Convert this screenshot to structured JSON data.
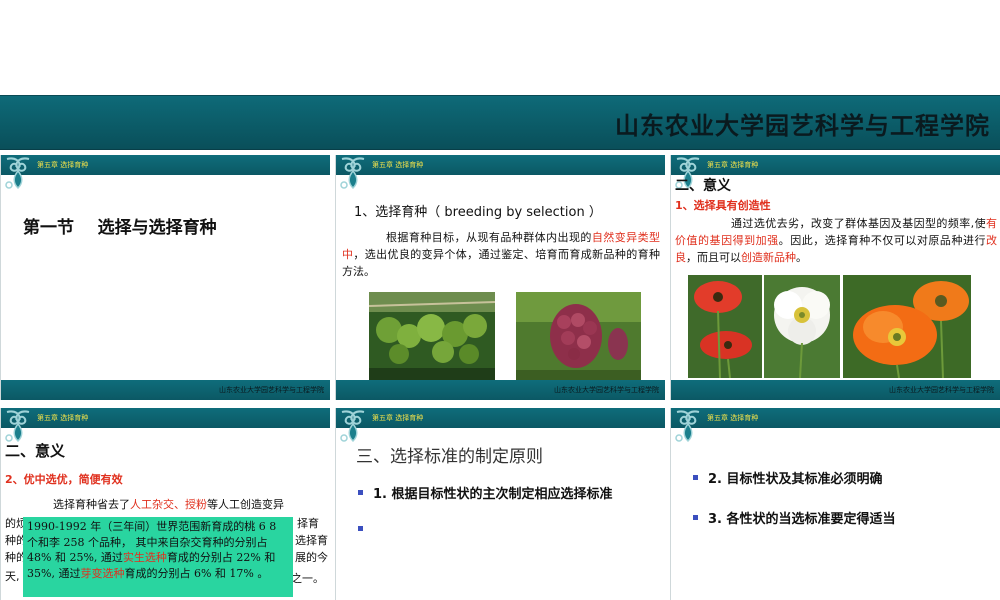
{
  "banner": {
    "title": "山东农业大学园艺科学与工程学院"
  },
  "common": {
    "chapter": "第五章  选择育种",
    "footer": "山东农业大学园艺科学与工程学院"
  },
  "slide1": {
    "title": "第一节    选择与选择育种"
  },
  "slide2": {
    "heading": "1、选择育种（ breeding by selection ）",
    "para_a": "根据育种目标，从现有品种群体内出现的",
    "para_red": "自然变异类型中",
    "para_b": "，选出优良的变异个体，通过鉴定、培育而育成新品种的育种方法。"
  },
  "slide3": {
    "heading": "二、意义",
    "sub": "1、选择具有创造性",
    "para_a": "通过选优去劣，改变了群体基因及基因型的频率,使",
    "para_red1": "有价值的基因得到加强",
    "para_b": "。因此，选择育种不仅可以对原品种进行",
    "para_red2": "改良",
    "para_c": "，而且可以",
    "para_red3": "创造新品种",
    "para_d": "。"
  },
  "slide4": {
    "heading": "二、意义",
    "sub": "2、优中选优，简便有效",
    "para_a": "选择育种省去了",
    "para_red1": "人工杂交、授粉",
    "para_b": "等人工创造变异",
    "line2_left": "的烦",
    "line2_right": "择育",
    "line3_left": "种的",
    "line3_right": "选择育",
    "line4_left": "种的",
    "line4_right": "展的今",
    "line5_left": "天,",
    "line5_right": "之一。",
    "popup_a": "1990-1992 年（三年间）世界范围新育成的桃 6 8 个和李 258 个品种， 其中来自杂交育种的分别占 48%  和 25%,  通过",
    "popup_red1": "实生选种",
    "popup_b": "育成的分别占 22%  和 35%,  通过",
    "popup_red2": "芽变选种",
    "popup_c": "育成的分别占 6%  和 17%  。"
  },
  "slide5": {
    "heading": "三、选择标准的制定原则",
    "bullet1": "1.  根据目标性状的主次制定相应选择标准",
    "bullet2": ""
  },
  "slide6": {
    "bullet1": "2.  目标性状及其标准必须明确",
    "bullet2": "3.  各性状的当选标准要定得适当"
  },
  "colors": {
    "teal": "#0b5864",
    "accent_red": "#e0301e",
    "bullet_blue": "#3b4fbf",
    "popup_green": "#29d5a0",
    "chapter_yellow": "#f2e24a"
  }
}
